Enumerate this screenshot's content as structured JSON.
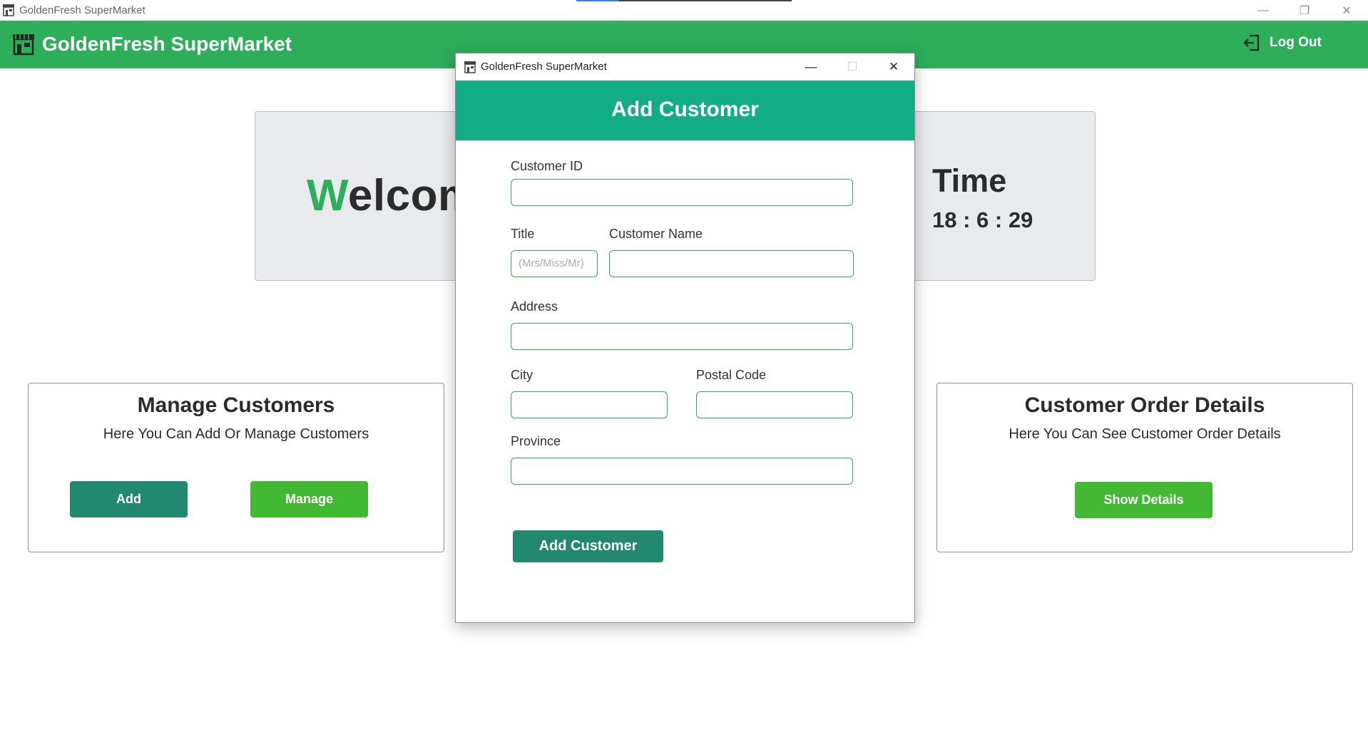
{
  "window": {
    "title": "GoldenFresh SuperMarket",
    "controls": {
      "minimize": "—",
      "restore": "❐",
      "close": "✕"
    }
  },
  "header": {
    "brand": "GoldenFresh SuperMarket",
    "logout_label": "Log Out",
    "bg_color": "#2ead5b"
  },
  "welcome": {
    "first_letter": "W",
    "rest": "elcome",
    "time_label": "Time",
    "time_value": "18 : 6 : 29"
  },
  "cards": {
    "manage_customers": {
      "title": "Manage Customers",
      "description": "Here You Can  Add Or Manage Customers",
      "add_label": "Add",
      "manage_label": "Manage"
    },
    "order_details": {
      "title": "Customer Order Details",
      "description": "Here You Can See Customer Order Details",
      "show_label": "Show Details"
    }
  },
  "dialog": {
    "window_title": "GoldenFresh SuperMarket",
    "controls": {
      "minimize": "—",
      "maximize": "☐",
      "close": "✕"
    },
    "heading": "Add Customer",
    "header_color": "#12ad84",
    "fields": {
      "customer_id": {
        "label": "Customer ID",
        "value": ""
      },
      "title": {
        "label": "Title",
        "placeholder": "(Mrs/Miss/Mr)",
        "value": ""
      },
      "customer_name": {
        "label": "Customer Name",
        "value": ""
      },
      "address": {
        "label": "Address",
        "value": ""
      },
      "city": {
        "label": "City",
        "value": ""
      },
      "postal_code": {
        "label": "Postal Code",
        "value": ""
      },
      "province": {
        "label": "Province",
        "value": ""
      }
    },
    "submit_label": "Add Customer"
  },
  "icons": {
    "app": "store-icon",
    "logout": "logout-icon"
  }
}
